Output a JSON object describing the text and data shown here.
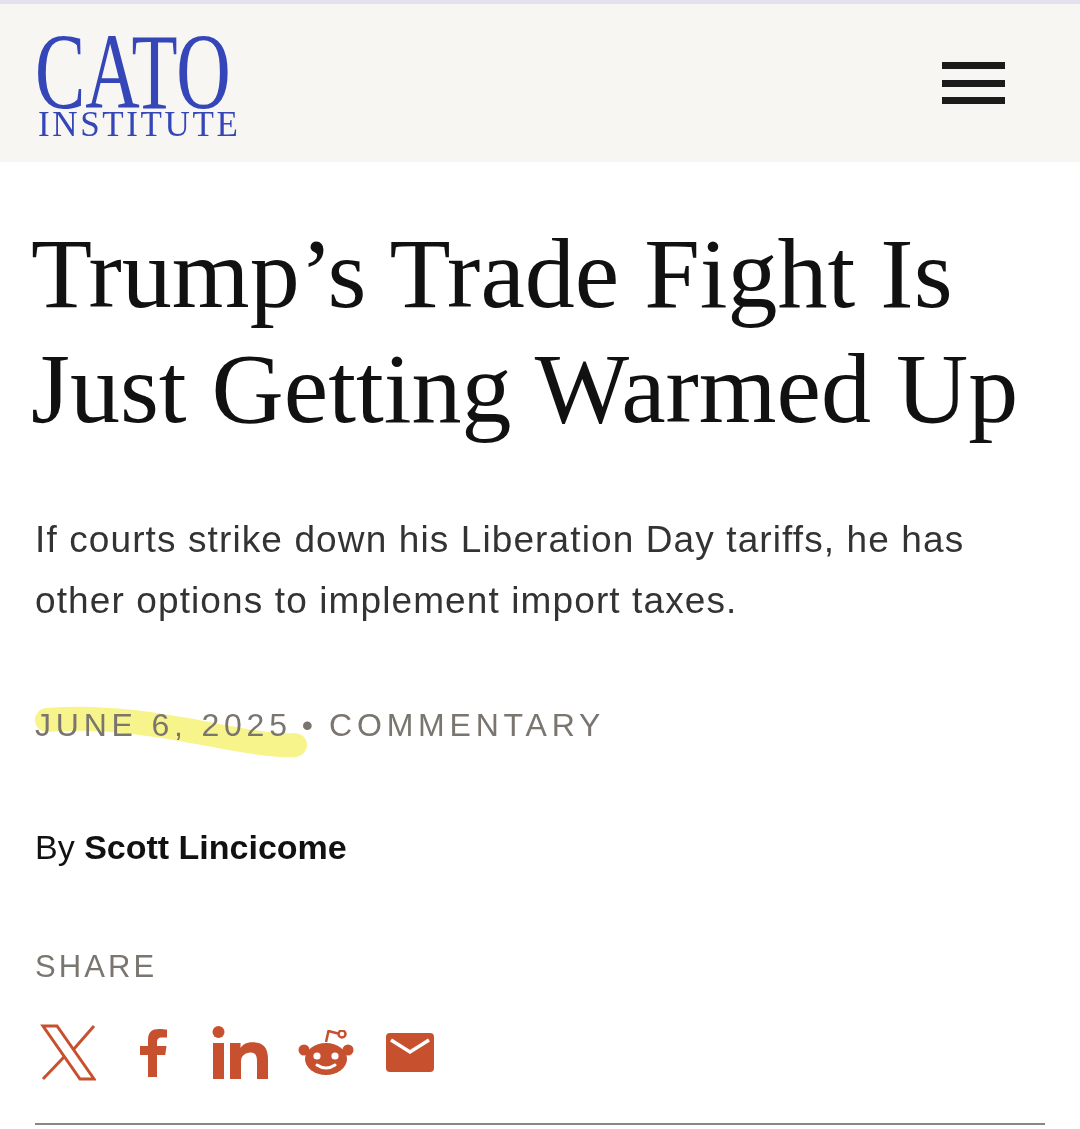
{
  "header": {
    "logo": {
      "wordmark": "CATO",
      "subtitle": "INSTITUTE"
    }
  },
  "article": {
    "title": "Trump’s Trade Fight Is Just Getting Warmed Up",
    "dek": "If courts strike down his Liberation Day tariffs, he has other options to implement import taxes.",
    "meta": {
      "date": "JUNE 6, 2025",
      "date_highlighted": true,
      "separator": "•",
      "type": "COMMENTARY"
    },
    "byline": "By **Scott Lincicome**",
    "share": {
      "label": "SHARE"
    }
  }
}
